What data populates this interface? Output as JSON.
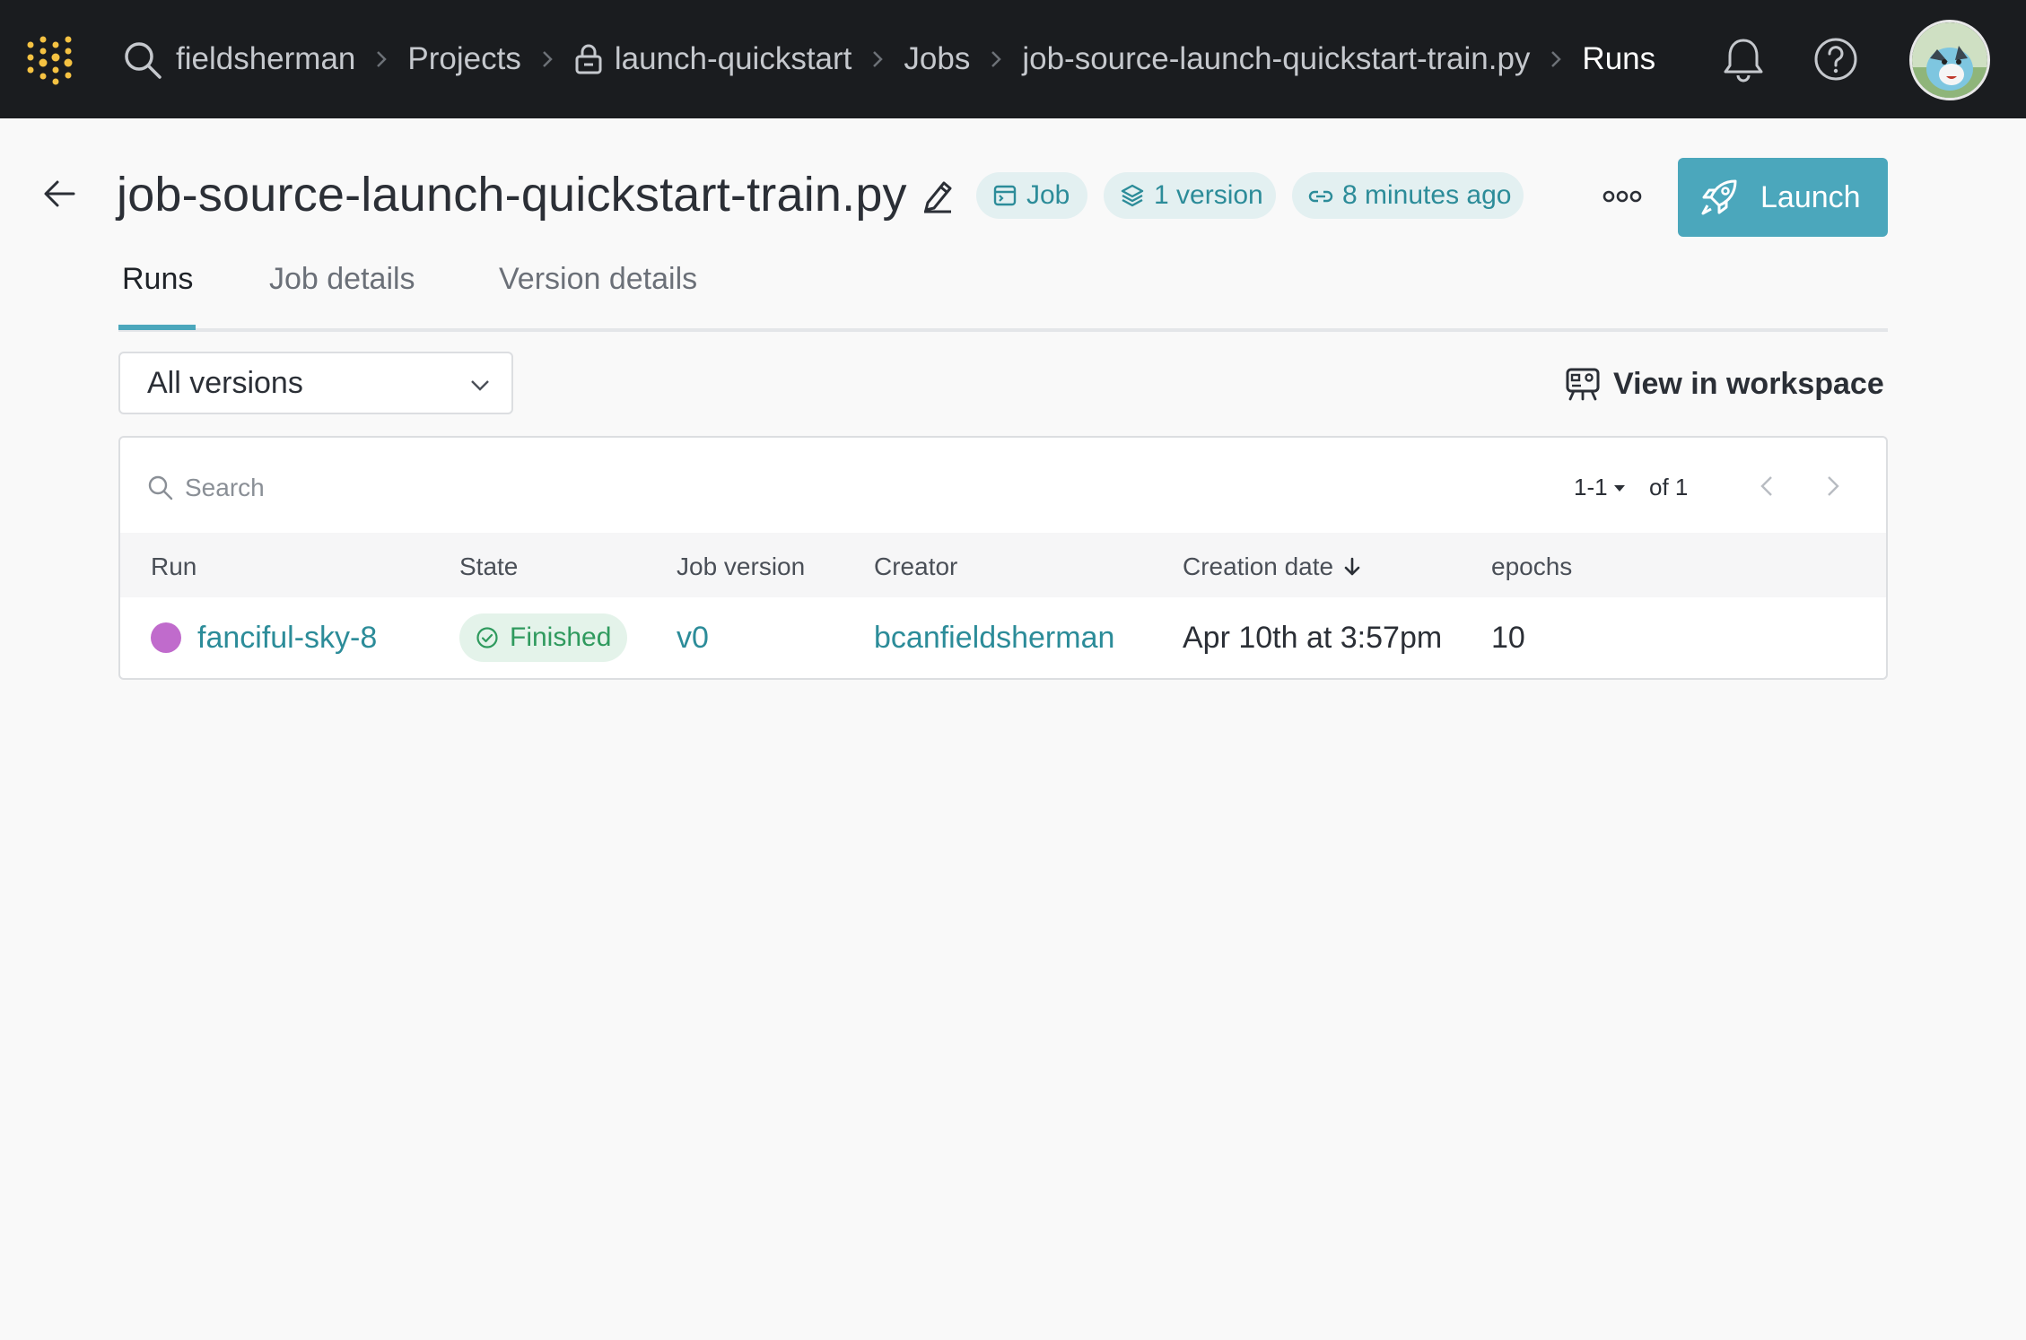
{
  "nav": {
    "breadcrumbs": [
      {
        "label": "fieldsherman"
      },
      {
        "label": "Projects"
      },
      {
        "label": "launch-quickstart",
        "icon": "lock-icon"
      },
      {
        "label": "Jobs"
      },
      {
        "label": "job-source-launch-quickstart-train.py"
      },
      {
        "label": "Runs"
      }
    ],
    "icons": [
      "app-logo-icon",
      "search-icon",
      "bell-icon",
      "help-icon"
    ]
  },
  "header": {
    "title": "job-source-launch-quickstart-train.py",
    "chips": {
      "type": "Job",
      "versions": "1 version",
      "updated": "8 minutes ago"
    },
    "launch_label": "Launch"
  },
  "tabs": [
    {
      "label": "Runs",
      "active": true
    },
    {
      "label": "Job details",
      "active": false
    },
    {
      "label": "Version details",
      "active": false
    }
  ],
  "filters": {
    "version_select": "All versions",
    "workspace_link": "View in workspace"
  },
  "table": {
    "search_placeholder": "Search",
    "pager": {
      "range": "1-1",
      "of": "of 1"
    },
    "columns": [
      "Run",
      "State",
      "Job version",
      "Creator",
      "Creation date",
      "epochs"
    ],
    "sort_column": "Creation date",
    "sort_direction": "descending",
    "rows": [
      {
        "run": "fanciful-sky-8",
        "run_color": "#c06bcc",
        "state": "Finished",
        "job_version": "v0",
        "creator": "bcanfieldsherman",
        "creation_date": "Apr 10th at 3:57pm",
        "epochs": "10"
      }
    ]
  },
  "colors": {
    "accent": "#4ba7bc",
    "link": "#2c8c99",
    "nav_bg": "#1a1c1f",
    "success": "#2f9a5e"
  }
}
